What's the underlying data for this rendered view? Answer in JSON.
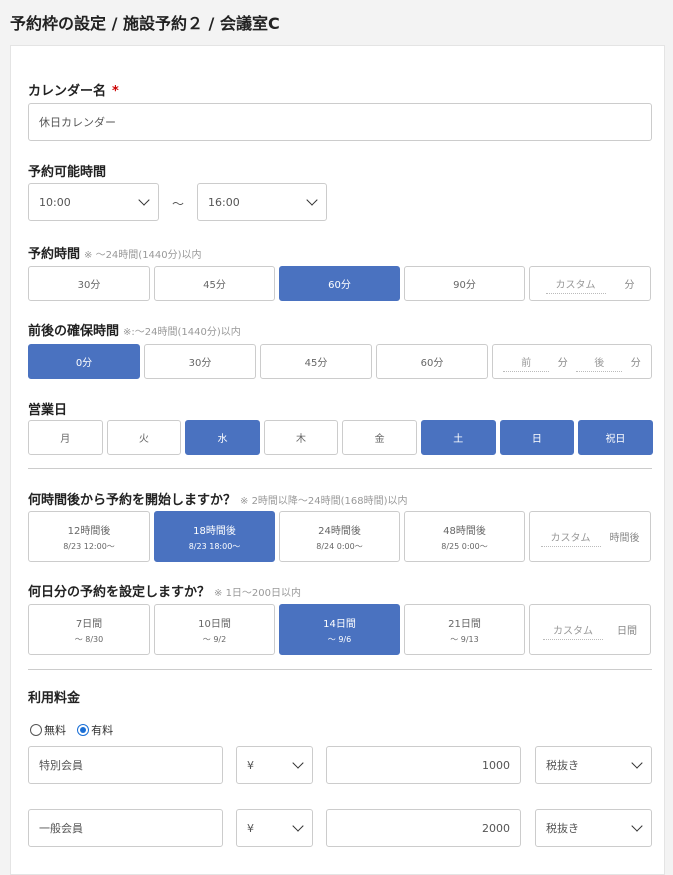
{
  "header": {
    "title": "予約枠の設定 / 施設予約２ / 会議室C"
  },
  "calendar_name": {
    "label": "カレンダー名",
    "required": "*",
    "value": "休日カレンダー"
  },
  "available_time": {
    "label": "予約可能時間",
    "start": "10:00",
    "separator": "～",
    "end": "16:00"
  },
  "duration": {
    "label": "予約時間",
    "note": "※ ～24時間(1440分)以内",
    "options": [
      "30分",
      "45分",
      "60分",
      "90分"
    ],
    "selected": "60分",
    "custom_placeholder": "カスタム",
    "custom_unit": "分"
  },
  "buffer": {
    "label": "前後の確保時間",
    "note": "※:～24時間(1440分)以内",
    "options": [
      "0分",
      "30分",
      "45分",
      "60分"
    ],
    "selected": "0分",
    "before_placeholder": "前",
    "before_unit": "分",
    "after_placeholder": "後",
    "after_unit": "分"
  },
  "business_days": {
    "label": "営業日",
    "days": [
      {
        "label": "月",
        "on": false
      },
      {
        "label": "火",
        "on": false
      },
      {
        "label": "水",
        "on": true
      },
      {
        "label": "木",
        "on": false
      },
      {
        "label": "金",
        "on": false
      },
      {
        "label": "土",
        "on": true
      },
      {
        "label": "日",
        "on": true
      },
      {
        "label": "祝日",
        "on": true
      }
    ]
  },
  "start_after": {
    "label": "何時間後から予約を開始しますか？",
    "note": "※ 2時間以降～24時間(168時間)以内",
    "options": [
      {
        "label": "12時間後",
        "sub": "8/23 12:00～"
      },
      {
        "label": "18時間後",
        "sub": "8/23 18:00～"
      },
      {
        "label": "24時間後",
        "sub": "8/24 0:00～"
      },
      {
        "label": "48時間後",
        "sub": "8/25 0:00～"
      }
    ],
    "selected": 1,
    "custom_placeholder": "カスタム",
    "custom_unit": "時間後"
  },
  "days_ahead": {
    "label": "何日分の予約を設定しますか？",
    "note": "※ 1日～200日以内",
    "options": [
      {
        "label": "7日間",
        "sub": "～ 8/30"
      },
      {
        "label": "10日間",
        "sub": "～ 9/2"
      },
      {
        "label": "14日間",
        "sub": "～ 9/6"
      },
      {
        "label": "21日間",
        "sub": "～ 9/13"
      }
    ],
    "selected": 2,
    "custom_placeholder": "カスタム",
    "custom_unit": "日間"
  },
  "fee": {
    "label": "利用料金",
    "free": "無料",
    "paid": "有料",
    "selected": "有料",
    "rows": [
      {
        "name": "特別会員",
        "currency": "¥",
        "amount": "1000",
        "tax": "税抜き"
      },
      {
        "name": "一般会員",
        "currency": "¥",
        "amount": "2000",
        "tax": "税抜き"
      }
    ]
  },
  "colors": {
    "accent": "#4a72c0"
  }
}
